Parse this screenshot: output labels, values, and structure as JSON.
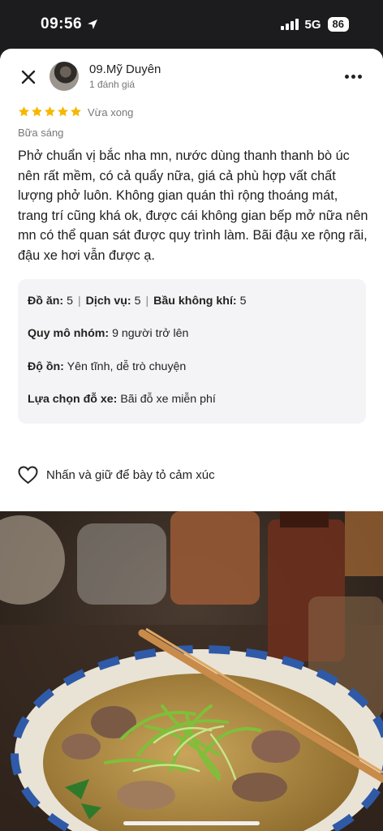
{
  "status": {
    "time": "09:56",
    "network": "5G",
    "battery": "86"
  },
  "review": {
    "author": "09.Mỹ Duyên",
    "author_reviews": "1 đánh giá",
    "rating": 5,
    "time": "Vừa xong",
    "meal": "Bữa sáng",
    "text": "Phở chuẩn vị bắc nha mn, nước dùng thanh thanh bò úc nên rất mềm, có cả quẩy nữa, giá cả phù hợp vất chất lượng phở luôn. Không gian quán thì rộng thoáng mát, trang trí cũng khá ok, được cái không gian bếp mở nữa nên mn có thể quan sát được quy trình làm. Bãi đậu xe rộng rãi, đậu xe hơi vẫn được ạ."
  },
  "details": {
    "food_label": "Đồ ăn:",
    "food_value": "5",
    "service_label": "Dịch vụ:",
    "service_value": "5",
    "atmos_label": "Bầu không khí:",
    "atmos_value": "5",
    "group_label": "Quy mô nhóm:",
    "group_value": "9 người trở lên",
    "noise_label": "Độ ồn:",
    "noise_value": "Yên tĩnh, dễ trò chuyện",
    "parking_label": "Lựa chọn đỗ xe:",
    "parking_value": "Bãi đỗ xe miễn phí"
  },
  "reaction": {
    "label": "Nhấn và giữ để bày tỏ cảm xúc"
  },
  "icons": {
    "close": "close-icon",
    "more": "more-icon",
    "heart": "heart-icon",
    "star": "star-icon",
    "location": "location-arrow-icon"
  },
  "colors": {
    "star": "#f5b800",
    "sheet": "#ffffff",
    "card": "#f4f4f6"
  }
}
